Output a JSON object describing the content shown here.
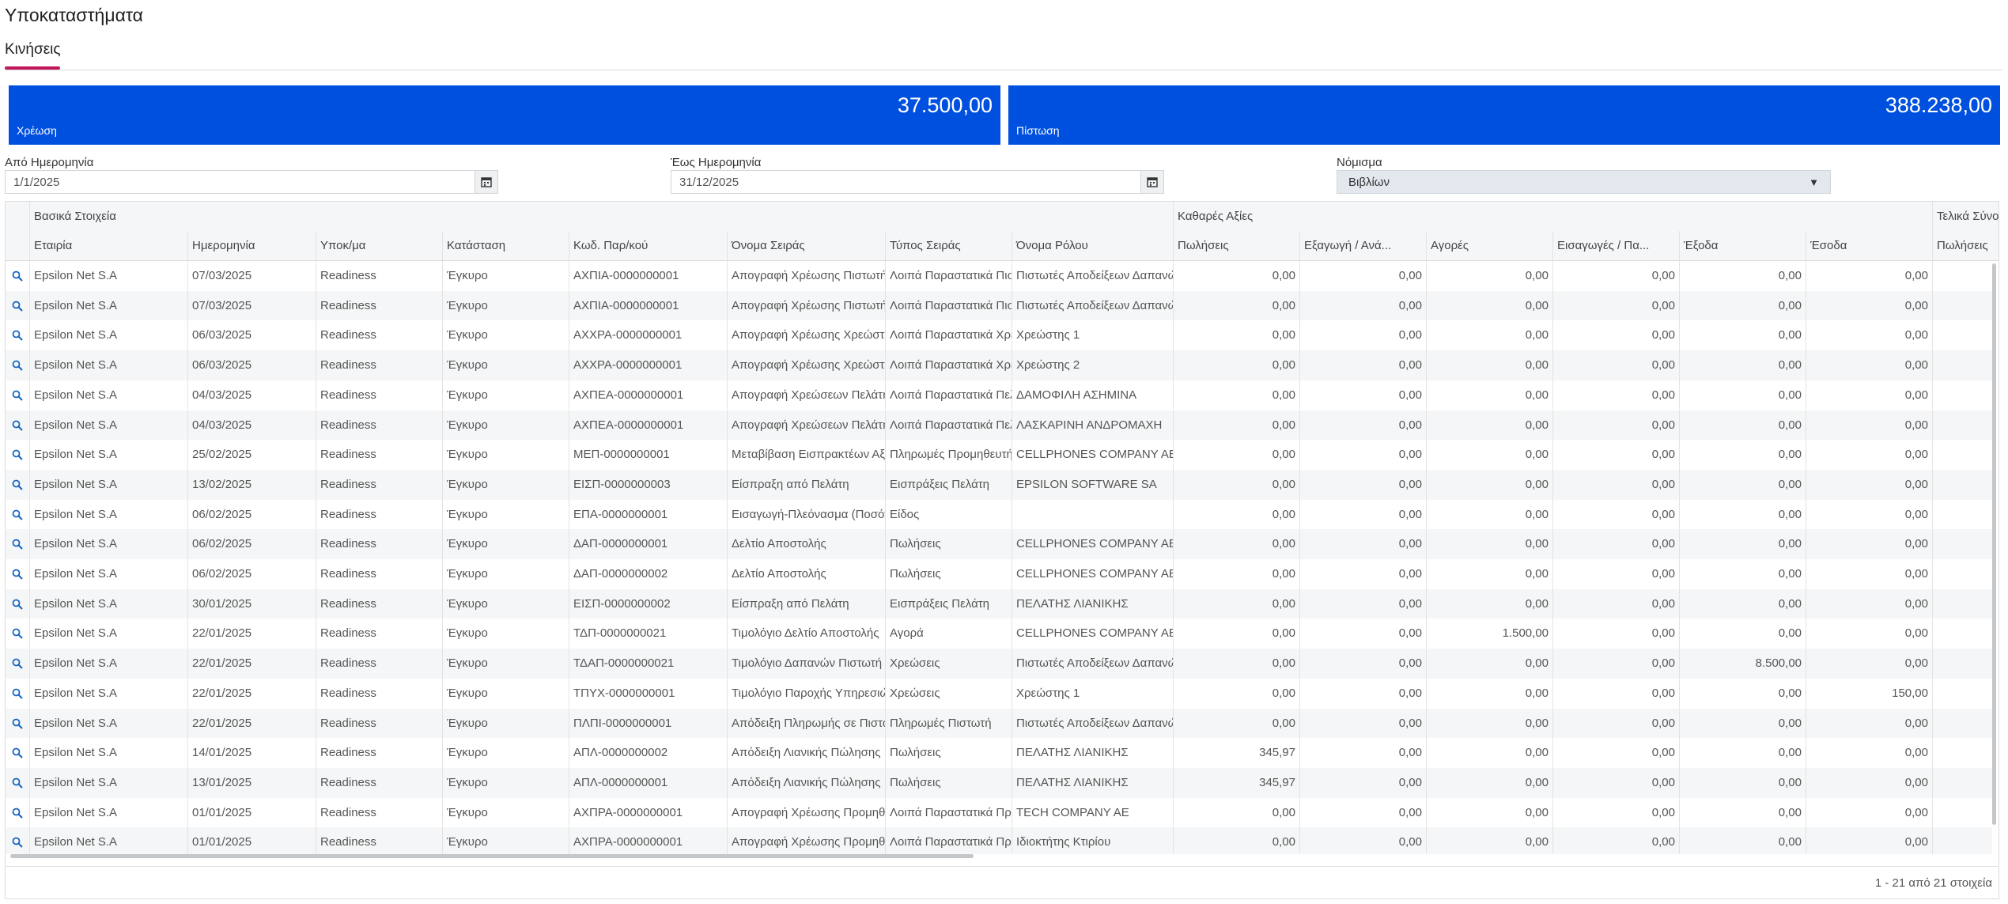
{
  "page_title": "Υποκαταστήματα",
  "tabs": [
    {
      "label": "Κινήσεις",
      "active": true
    }
  ],
  "cards": [
    {
      "amount": "37.500,00",
      "label": "Χρέωση",
      "color": "#0050e0"
    },
    {
      "amount": "388.238,00",
      "label": "Πίστωση",
      "color": "#0050e0"
    }
  ],
  "filters": {
    "from_label": "Από Ημερομηνία",
    "from_value": "1/1/2025",
    "to_label": "Έως Ημερομηνία",
    "to_value": "31/12/2025",
    "currency_label": "Νόμισμα",
    "currency_value": "Βιβλίων"
  },
  "grid": {
    "groups": [
      "Βασικά Στοιχεία",
      "Καθαρές Αξίες",
      "Τελικά Σύνολ"
    ],
    "columns": [
      "Εταιρία",
      "Ημερομηνία",
      "Υποκ/μα",
      "Κατάσταση",
      "Κωδ. Παρ/κού",
      "Όνομα Σειράς",
      "Τύπος Σειράς",
      "Όνομα Ρόλου",
      "Πωλήσεις",
      "Εξαγωγή / Ανά...",
      "Αγορές",
      "Εισαγωγές / Πα...",
      "Έξοδα",
      "Έσοδα",
      "Πωλήσεις"
    ],
    "rows": [
      [
        "Epsilon Net S.A",
        "07/03/2025",
        "Readiness",
        "Έγκυρο",
        "ΑΧΠΙΑ-0000000001",
        "Απογραφή Χρέωσης Πιστωτή",
        "Λοιπά Παραστατικά Πιστ",
        "Πιστωτές Αποδείξεων Δαπανών",
        "0,00",
        "0,00",
        "0,00",
        "0,00",
        "0,00",
        "0,00",
        ""
      ],
      [
        "Epsilon Net S.A",
        "07/03/2025",
        "Readiness",
        "Έγκυρο",
        "ΑΧΠΙΑ-0000000001",
        "Απογραφή Χρέωσης Πιστωτή",
        "Λοιπά Παραστατικά Πιστ",
        "Πιστωτές Αποδείξεων Δαπανών",
        "0,00",
        "0,00",
        "0,00",
        "0,00",
        "0,00",
        "0,00",
        ""
      ],
      [
        "Epsilon Net S.A",
        "06/03/2025",
        "Readiness",
        "Έγκυρο",
        "ΑΧΧΡΑ-0000000001",
        "Απογραφή Χρέωσης Χρεώστη",
        "Λοιπά Παραστατικά Χρε",
        "Χρεώστης 1",
        "0,00",
        "0,00",
        "0,00",
        "0,00",
        "0,00",
        "0,00",
        ""
      ],
      [
        "Epsilon Net S.A",
        "06/03/2025",
        "Readiness",
        "Έγκυρο",
        "ΑΧΧΡΑ-0000000001",
        "Απογραφή Χρέωσης Χρεώστη",
        "Λοιπά Παραστατικά Χρε",
        "Χρεώστης 2",
        "0,00",
        "0,00",
        "0,00",
        "0,00",
        "0,00",
        "0,00",
        ""
      ],
      [
        "Epsilon Net S.A",
        "04/03/2025",
        "Readiness",
        "Έγκυρο",
        "ΑΧΠΕΑ-0000000001",
        "Απογραφή Χρεώσεων Πελάτη",
        "Λοιπά Παραστατικά Πελ",
        "ΔΑΜΟΦΙΛΗ ΑΣΗΜΙΝΑ",
        "0,00",
        "0,00",
        "0,00",
        "0,00",
        "0,00",
        "0,00",
        ""
      ],
      [
        "Epsilon Net S.A",
        "04/03/2025",
        "Readiness",
        "Έγκυρο",
        "ΑΧΠΕΑ-0000000001",
        "Απογραφή Χρεώσεων Πελάτη",
        "Λοιπά Παραστατικά Πελ",
        "ΛΑΣΚΑΡΙΝΗ ΑΝΔΡΟΜΑΧΗ",
        "0,00",
        "0,00",
        "0,00",
        "0,00",
        "0,00",
        "0,00",
        ""
      ],
      [
        "Epsilon Net S.A",
        "25/02/2025",
        "Readiness",
        "Έγκυρο",
        "ΜΕΠ-0000000001",
        "Μεταβίβαση Εισπρακτέων Αξ",
        "Πληρωμές Προμηθευτή",
        "CELLPHONES COMPANY AE",
        "0,00",
        "0,00",
        "0,00",
        "0,00",
        "0,00",
        "0,00",
        ""
      ],
      [
        "Epsilon Net S.A",
        "13/02/2025",
        "Readiness",
        "Έγκυρο",
        "ΕΙΣΠ-0000000003",
        "Είσπραξη από Πελάτη",
        "Εισπράξεις Πελάτη",
        "EPSILON SOFTWARE SA",
        "0,00",
        "0,00",
        "0,00",
        "0,00",
        "0,00",
        "0,00",
        ""
      ],
      [
        "Epsilon Net S.A",
        "06/02/2025",
        "Readiness",
        "Έγκυρο",
        "ΕΠΑ-0000000001",
        "Εισαγωγή-Πλεόνασμα (Ποσότ",
        "Είδος",
        "",
        "0,00",
        "0,00",
        "0,00",
        "0,00",
        "0,00",
        "0,00",
        ""
      ],
      [
        "Epsilon Net S.A",
        "06/02/2025",
        "Readiness",
        "Έγκυρο",
        "ΔΑΠ-0000000001",
        "Δελτίο Αποστολής",
        "Πωλήσεις",
        "CELLPHONES COMPANY AE",
        "0,00",
        "0,00",
        "0,00",
        "0,00",
        "0,00",
        "0,00",
        ""
      ],
      [
        "Epsilon Net S.A",
        "06/02/2025",
        "Readiness",
        "Έγκυρο",
        "ΔΑΠ-0000000002",
        "Δελτίο Αποστολής",
        "Πωλήσεις",
        "CELLPHONES COMPANY AE",
        "0,00",
        "0,00",
        "0,00",
        "0,00",
        "0,00",
        "0,00",
        ""
      ],
      [
        "Epsilon Net S.A",
        "30/01/2025",
        "Readiness",
        "Έγκυρο",
        "ΕΙΣΠ-0000000002",
        "Είσπραξη από Πελάτη",
        "Εισπράξεις Πελάτη",
        "ΠΕΛΑΤΗΣ ΛΙΑΝΙΚΗΣ",
        "0,00",
        "0,00",
        "0,00",
        "0,00",
        "0,00",
        "0,00",
        ""
      ],
      [
        "Epsilon Net S.A",
        "22/01/2025",
        "Readiness",
        "Έγκυρο",
        "ΤΔΠ-0000000021",
        "Τιμολόγιο Δελτίο Αποστολής",
        "Αγορά",
        "CELLPHONES COMPANY AE",
        "0,00",
        "0,00",
        "1.500,00",
        "0,00",
        "0,00",
        "0,00",
        ""
      ],
      [
        "Epsilon Net S.A",
        "22/01/2025",
        "Readiness",
        "Έγκυρο",
        "ΤΔΑΠ-0000000021",
        "Τιμολόγιο Δαπανών Πιστωτή",
        "Χρεώσεις",
        "Πιστωτές Αποδείξεων Δαπανών",
        "0,00",
        "0,00",
        "0,00",
        "0,00",
        "8.500,00",
        "0,00",
        ""
      ],
      [
        "Epsilon Net S.A",
        "22/01/2025",
        "Readiness",
        "Έγκυρο",
        "ΤΠΥΧ-0000000001",
        "Τιμολόγιο Παροχής Υπηρεσιώ",
        "Χρεώσεις",
        "Χρεώστης 1",
        "0,00",
        "0,00",
        "0,00",
        "0,00",
        "0,00",
        "150,00",
        ""
      ],
      [
        "Epsilon Net S.A",
        "22/01/2025",
        "Readiness",
        "Έγκυρο",
        "ΠΛΠΙ-0000000001",
        "Απόδειξη Πληρωμής σε Πιστω",
        "Πληρωμές Πιστωτή",
        "Πιστωτές Αποδείξεων Δαπανών",
        "0,00",
        "0,00",
        "0,00",
        "0,00",
        "0,00",
        "0,00",
        ""
      ],
      [
        "Epsilon Net S.A",
        "14/01/2025",
        "Readiness",
        "Έγκυρο",
        "ΑΠΛ-0000000002",
        "Απόδειξη Λιανικής Πώλησης",
        "Πωλήσεις",
        "ΠΕΛΑΤΗΣ ΛΙΑΝΙΚΗΣ",
        "345,97",
        "0,00",
        "0,00",
        "0,00",
        "0,00",
        "0,00",
        ""
      ],
      [
        "Epsilon Net S.A",
        "13/01/2025",
        "Readiness",
        "Έγκυρο",
        "ΑΠΛ-0000000001",
        "Απόδειξη Λιανικής Πώλησης",
        "Πωλήσεις",
        "ΠΕΛΑΤΗΣ ΛΙΑΝΙΚΗΣ",
        "345,97",
        "0,00",
        "0,00",
        "0,00",
        "0,00",
        "0,00",
        ""
      ],
      [
        "Epsilon Net S.A",
        "01/01/2025",
        "Readiness",
        "Έγκυρο",
        "ΑΧΠΡΑ-0000000001",
        "Απογραφή Χρέωσης Προμηθε",
        "Λοιπά Παραστατικά Προ",
        "TECH COMPANY AE",
        "0,00",
        "0,00",
        "0,00",
        "0,00",
        "0,00",
        "0,00",
        ""
      ],
      [
        "Epsilon Net S.A",
        "01/01/2025",
        "Readiness",
        "Έγκυρο",
        "ΑΧΠΡΑ-0000000001",
        "Απογραφή Χρέωσης Προμηθε",
        "Λοιπά Παραστατικά Προ",
        "Ιδιοκτήτης Κτιρίου",
        "0,00",
        "0,00",
        "0,00",
        "0,00",
        "0,00",
        "0,00",
        ""
      ]
    ],
    "pager": "1 - 21 από 21 στοιχεία"
  }
}
